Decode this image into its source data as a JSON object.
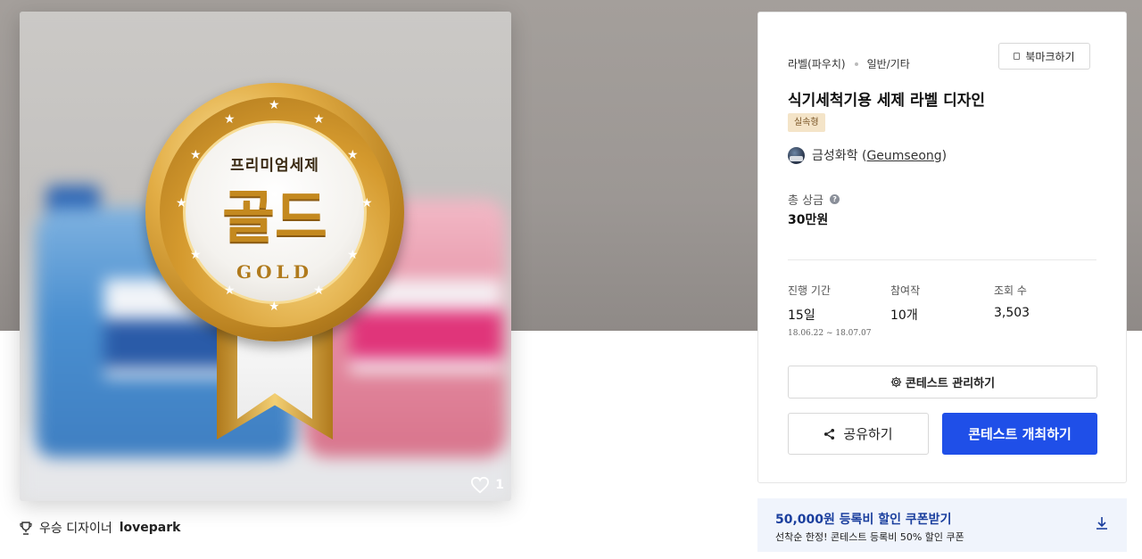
{
  "image": {
    "medal_top_text": "프리미엄세제",
    "medal_big_text": "골드",
    "medal_gold_text": "GOLD",
    "like_count": "1"
  },
  "winner": {
    "prefix": "우승 디자이너",
    "name": "lovepark"
  },
  "card": {
    "category": "라벨(파우치)",
    "subcategory": "일반/기타",
    "bookmark_label": "북마크하기",
    "title": "식기세척기용 세제 라벨 디자인",
    "badge": "실속형",
    "host_name": "금성화학",
    "host_en": "Geumseong",
    "prize_label": "총 상금",
    "prize_value": "30만원",
    "stats": [
      {
        "label": "진행 기간",
        "value": "15일",
        "sub": "18.06.22 ~ 18.07.07"
      },
      {
        "label": "참여작",
        "value": "10개"
      },
      {
        "label": "조회 수",
        "value": "3,503"
      }
    ],
    "manage_label": "콘테스트 관리하기",
    "share_label": "공유하기",
    "host_contest_label": "콘테스트 개최하기"
  },
  "coupon": {
    "title": "50,000원 등록비 할인 쿠폰받기",
    "subtitle": "선착순 한정! 콘테스트 등록비 50% 할인 쿠폰"
  },
  "colors": {
    "primary_button": "#1f4fe8",
    "coupon_bg": "#f0f4fc",
    "coupon_title": "#1b3f9e",
    "badge_bg": "#f4e4c8"
  },
  "icons": [
    "heart-icon",
    "trophy-icon",
    "bookmark-icon",
    "help-icon",
    "gear-icon",
    "share-icon",
    "download-icon"
  ]
}
